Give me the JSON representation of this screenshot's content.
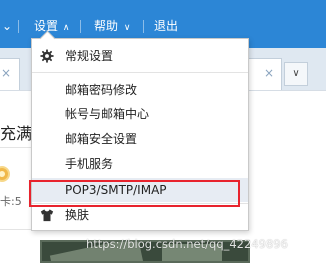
{
  "topnav": {
    "left_chevron": "⌄",
    "settings_label": "设置",
    "help_label": "帮助",
    "logout_label": "退出"
  },
  "settings_menu": {
    "items": [
      {
        "label": "常规设置",
        "icon": "gear-icon"
      },
      {
        "label": "邮箱密码修改"
      },
      {
        "label": "帐号与邮箱中心"
      },
      {
        "label": "邮箱安全设置"
      },
      {
        "label": "手机服务"
      },
      {
        "label": "POP3/SMTP/IMAP",
        "highlighted": true
      },
      {
        "label": "换肤",
        "icon": "tshirt-icon"
      }
    ]
  },
  "background": {
    "text_fragment": "充满",
    "count_fragment": "卡:5"
  },
  "watermark": "https://blog.csdn.net/qq_42249896",
  "colors": {
    "topbar": "#2c86d6",
    "highlight_border": "#e8232d",
    "hover_bg": "#e7ecf3"
  }
}
